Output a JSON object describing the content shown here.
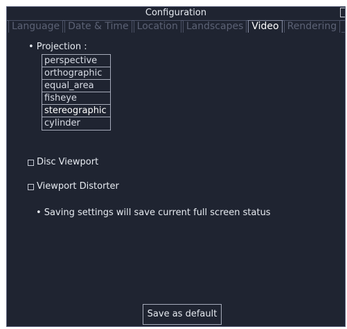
{
  "window": {
    "title": "Configuration"
  },
  "tabs": [
    {
      "label": "Language",
      "active": false
    },
    {
      "label": "Date & Time",
      "active": false
    },
    {
      "label": "Location",
      "active": false
    },
    {
      "label": "Landscapes",
      "active": false
    },
    {
      "label": "Video",
      "active": true
    },
    {
      "label": "Rendering",
      "active": false
    }
  ],
  "video": {
    "projection_label": "• Projection :",
    "projections": [
      "perspective",
      "orthographic",
      "equal_area",
      "fisheye",
      "stereographic",
      "cylinder"
    ],
    "selected_projection": "stereographic",
    "disc_viewport_label": "Disc Viewport",
    "disc_viewport_checked": false,
    "viewport_distorter_label": "Viewport Distorter",
    "viewport_distorter_checked": false,
    "note": "• Saving settings will save current full screen status",
    "save_button_label": "Save as default"
  }
}
